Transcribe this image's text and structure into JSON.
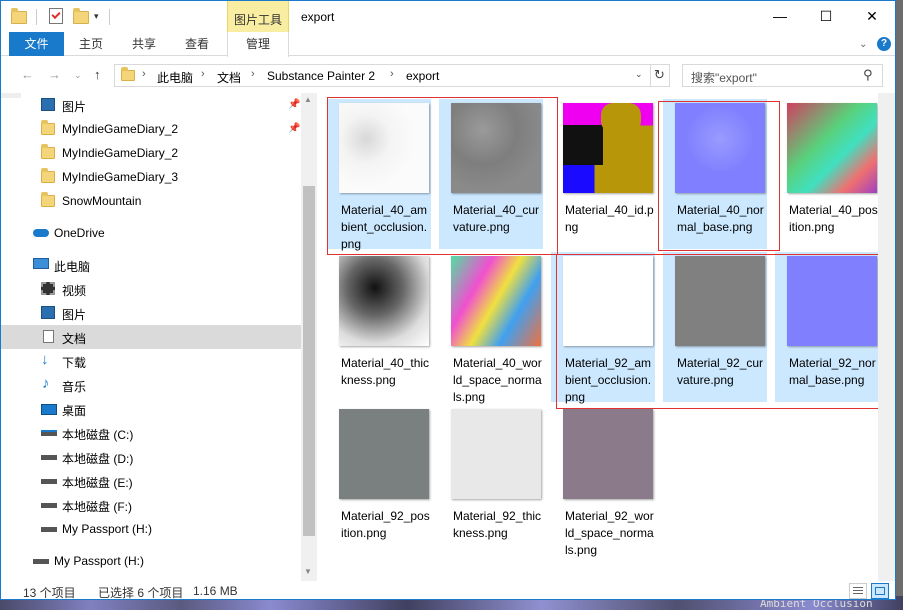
{
  "window": {
    "title": "export",
    "context_tab": "图片工具",
    "minimize": "—",
    "maximize": "☐",
    "close": "✕"
  },
  "ribbon": {
    "file": "文件",
    "tabs": [
      "主页",
      "共享",
      "查看"
    ],
    "manage": "管理"
  },
  "navigation": {
    "breadcrumb": [
      "此电脑",
      "文档",
      "Substance Painter 2",
      "export"
    ],
    "search_placeholder": "搜索\"export\""
  },
  "sidebar": {
    "quick_access": [
      {
        "label": "图片",
        "pinned": true
      },
      {
        "label": "MyIndieGameDiary_2",
        "pinned": true
      },
      {
        "label": "MyIndieGameDiary_2",
        "pinned": false
      },
      {
        "label": "MyIndieGameDiary_3",
        "pinned": false
      },
      {
        "label": "SnowMountain",
        "pinned": false
      }
    ],
    "onedrive": "OneDrive",
    "this_pc": "此电脑",
    "pc_items": [
      {
        "label": "视频",
        "icon": "video-icon"
      },
      {
        "label": "图片",
        "icon": "pictures-icon"
      },
      {
        "label": "文档",
        "icon": "documents-icon"
      },
      {
        "label": "下载",
        "icon": "download-icon"
      },
      {
        "label": "音乐",
        "icon": "music-icon"
      },
      {
        "label": "桌面",
        "icon": "desktop-icon"
      },
      {
        "label": "本地磁盘 (C:)",
        "icon": "drive-icon"
      },
      {
        "label": "本地磁盘 (D:)",
        "icon": "drive-icon"
      },
      {
        "label": "本地磁盘 (E:)",
        "icon": "drive-icon"
      },
      {
        "label": "本地磁盘 (F:)",
        "icon": "drive-icon"
      },
      {
        "label": "My Passport (H:)",
        "icon": "drive-icon"
      }
    ],
    "external": "My Passport (H:)"
  },
  "files": [
    {
      "name": "Material_40_ambient_occlusion.png",
      "selected": true
    },
    {
      "name": "Material_40_curvature.png",
      "selected": true
    },
    {
      "name": "Material_40_id.png",
      "selected": false
    },
    {
      "name": "Material_40_normal_base.png",
      "selected": true
    },
    {
      "name": "Material_40_position.png",
      "selected": false
    },
    {
      "name": "Material_40_thickness.png",
      "selected": false
    },
    {
      "name": "Material_40_world_space_normals.png",
      "selected": false
    },
    {
      "name": "Material_92_ambient_occlusion.png",
      "selected": true
    },
    {
      "name": "Material_92_curvature.png",
      "selected": true
    },
    {
      "name": "Material_92_normal_base.png",
      "selected": true
    },
    {
      "name": "Material_92_position.png",
      "selected": false
    },
    {
      "name": "Material_92_thickness.png",
      "selected": false
    },
    {
      "name": "Material_92_world_space_normals.png",
      "selected": false
    }
  ],
  "status": {
    "count": "13 个项目",
    "selected": "已选择 6 个项目",
    "size": "1.16 MB"
  },
  "background_text": "Ambient Occlusion",
  "colors": {
    "accent": "#1979ca",
    "selection": "#cce8ff",
    "highlight_box": "#e03030"
  }
}
